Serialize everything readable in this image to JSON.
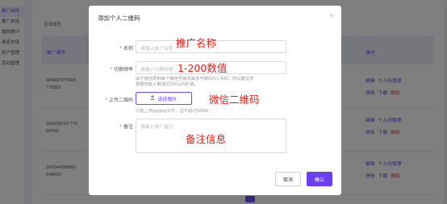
{
  "sidebar": {
    "items": [
      {
        "label": "推广启用"
      },
      {
        "label": "推广启用"
      },
      {
        "label": "播放统计"
      },
      {
        "label": "渠道市场"
      },
      {
        "label": "用户管理"
      },
      {
        "label": "活动管理"
      }
    ]
  },
  "background": {
    "tab_prefix": "全部",
    "tab_count": "3",
    "tab_suffix": "项",
    "col_code": "推广编号",
    "col_ops": "操作",
    "rows": [
      {
        "id": "384487075006779392",
        "edit": "编辑",
        "manage": "个人码管理",
        "disable": "停用",
        "download": "下载",
        "delete": "删除"
      },
      {
        "id": "369359214 77664768",
        "edit": "编辑",
        "manage": "个人码管理",
        "disable": "停用",
        "download": "下载",
        "delete": "删除"
      },
      {
        "id": "369344050660249600",
        "edit": "编辑",
        "manage": "个人码管理",
        "disable": "停用",
        "download": "下载",
        "delete": "删除"
      }
    ]
  },
  "modal": {
    "title": "添加个人二维码",
    "close_glyph": "×",
    "name_label": "名称",
    "name_placeholder": "请输入推广名称",
    "name_annotation": "推广名称",
    "freq_label": "切换频率",
    "freq_placeholder": "请输入切换频率",
    "freq_annotation": "1-200数值",
    "freq_hint_1": "由于微信限制每个微信号每天最多可被500人添加，所以建议您",
    "freq_hint_2": "根据现有人数填写200以内的值。",
    "qr_label": "上传二维码",
    "upload_label": "选择图片",
    "upload_icon": "upload-icon",
    "qr_annotation": "微信二维码",
    "upload_hint": "只能上传jpg/png文件，且不超过500kb",
    "remark_label": "备注",
    "remark_placeholder": "请输入推广备注",
    "remark_annotation": "备注信息",
    "cancel_label": "取消",
    "ok_label": "确认",
    "required_mark": "*"
  },
  "colors": {
    "accent": "#6b3ff0",
    "annotation_red": "#e0201a",
    "mask": "rgba(0,0,0,0.5)"
  }
}
